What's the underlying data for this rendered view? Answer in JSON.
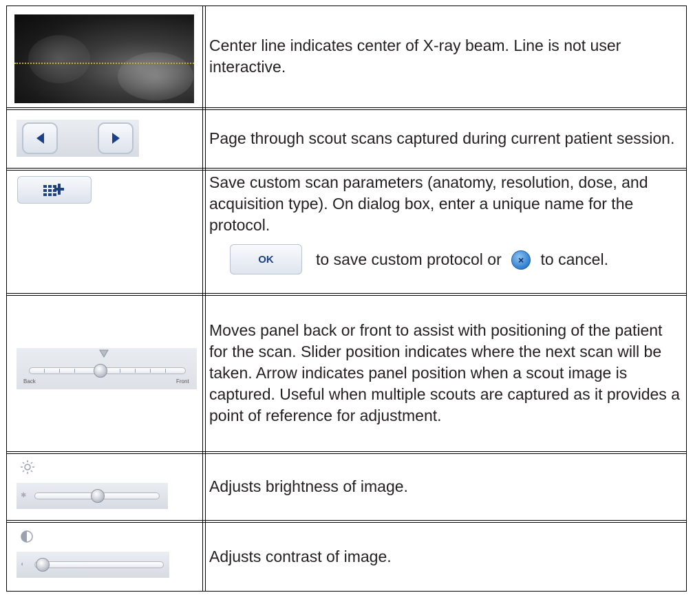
{
  "rows": [
    {
      "description": "Center line indicates center of X-ray beam. Line is not user interactive."
    },
    {
      "description": "Page through scout scans captured during current patient session."
    },
    {
      "description": "Save custom scan parameters (anatomy, resolution, dose, and acquisition type). On dialog box, enter a unique name for the protocol.",
      "ok_label": "OK",
      "ok_text": "to save custom protocol or",
      "cancel_glyph": "×",
      "cancel_text": "to cancel."
    },
    {
      "description": "Moves panel back or front to assist with positioning of the patient for the scan. Slider position indicates where the next scan will be taken. Arrow indicates panel position when a scout image is captured. Useful when multiple scouts are captured as it provides a point of reference for adjustment.",
      "slider_back": "Back",
      "slider_front": "Front"
    },
    {
      "description": "Adjusts brightness of image."
    },
    {
      "description": "Adjusts contrast of image."
    }
  ],
  "icons": {
    "prev": "previous-arrow-icon",
    "next": "next-arrow-icon",
    "save_protocol": "save-protocol-icon",
    "brightness": "brightness-icon",
    "contrast": "contrast-icon",
    "cancel": "cancel-icon"
  },
  "colors": {
    "accent_blue": "#1c3f86",
    "center_line": "#c9b21e"
  }
}
